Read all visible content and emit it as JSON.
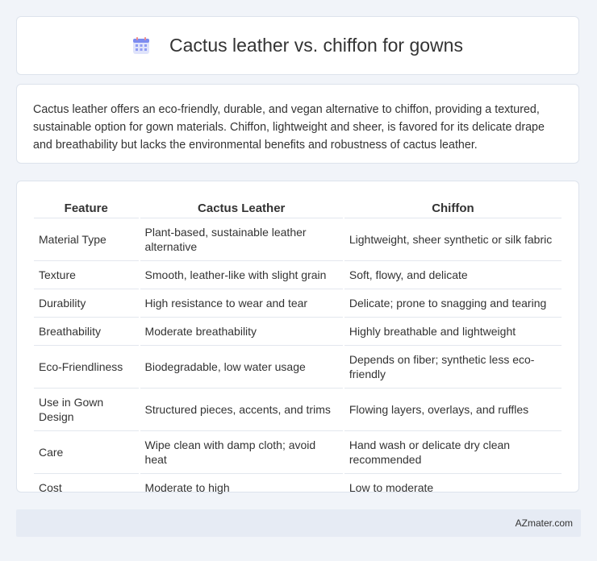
{
  "header": {
    "title": "Cactus leather vs. chiffon for gowns",
    "icon": "calendar-icon"
  },
  "intro": {
    "text": "Cactus leather offers an eco-friendly, durable, and vegan alternative to chiffon, providing a textured, sustainable option for gown materials. Chiffon, lightweight and sheer, is favored for its delicate drape and breathability but lacks the environmental benefits and robustness of cactus leather."
  },
  "table": {
    "headers": [
      "Feature",
      "Cactus Leather",
      "Chiffon"
    ],
    "rows": [
      [
        "Material Type",
        "Plant-based, sustainable leather alternative",
        "Lightweight, sheer synthetic or silk fabric"
      ],
      [
        "Texture",
        "Smooth, leather-like with slight grain",
        "Soft, flowy, and delicate"
      ],
      [
        "Durability",
        "High resistance to wear and tear",
        "Delicate; prone to snagging and tearing"
      ],
      [
        "Breathability",
        "Moderate breathability",
        "Highly breathable and lightweight"
      ],
      [
        "Eco-Friendliness",
        "Biodegradable, low water usage",
        "Depends on fiber; synthetic less eco-friendly"
      ],
      [
        "Use in Gown Design",
        "Structured pieces, accents, and trims",
        "Flowing layers, overlays, and ruffles"
      ],
      [
        "Care",
        "Wipe clean with damp cloth; avoid heat",
        "Hand wash or delicate dry clean recommended"
      ],
      [
        "Cost",
        "Moderate to high",
        "Low to moderate"
      ]
    ]
  },
  "footer": {
    "text": "AZmater.com"
  }
}
